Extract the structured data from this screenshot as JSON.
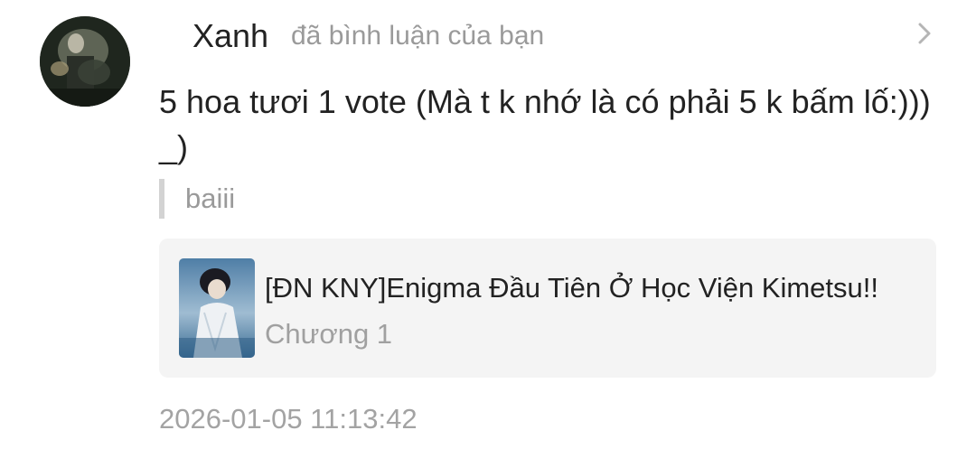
{
  "notification": {
    "username": "Xanh",
    "action": "đã bình luận của bạn",
    "comment": "5 hoa tươi 1 vote (Mà t k nhớ là có phải 5 k bấm lố:))) _)",
    "quoted_reply": "baiii",
    "story": {
      "title": "[ĐN KNY]Enigma Đầu Tiên Ở Học Viện Kimetsu!!",
      "chapter": "Chương 1"
    },
    "timestamp": "2026-01-05 11:13:42"
  },
  "icons": {
    "chevron": "chevron-right-icon",
    "avatar": "user-avatar",
    "cover": "story-cover-image"
  },
  "colors": {
    "primary_text": "#222222",
    "secondary_text": "#9a9a9a",
    "card_background": "#f4f4f4",
    "quote_bar": "#d3d3d3"
  }
}
